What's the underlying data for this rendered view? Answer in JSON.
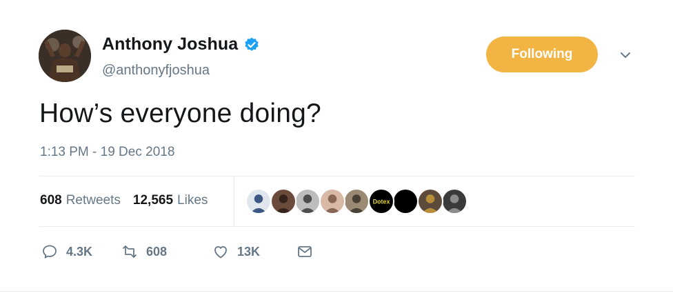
{
  "user": {
    "display_name": "Anthony Joshua",
    "handle": "@anthonyfjoshua",
    "verified": true
  },
  "follow_button": {
    "label": "Following",
    "color": "#f2b544"
  },
  "tweet": {
    "text": "How’s everyone doing?",
    "timestamp": "1:13 PM - 19 Dec 2018"
  },
  "stats": {
    "retweets": {
      "count": "608",
      "label": "Retweets"
    },
    "likes": {
      "count": "12,565",
      "label": "Likes"
    }
  },
  "likers": [
    {
      "name": "liker-avatar-1",
      "bg": "#dfe6ee",
      "fg": "#1f3d6e"
    },
    {
      "name": "liker-avatar-2",
      "bg": "#6a4a3a",
      "fg": "#2a1d16"
    },
    {
      "name": "liker-avatar-3",
      "bg": "#bdbdbd",
      "fg": "#3a3a3a"
    },
    {
      "name": "liker-avatar-4",
      "bg": "#d7b9a6",
      "fg": "#7a5646"
    },
    {
      "name": "liker-avatar-5",
      "bg": "#9a8a74",
      "fg": "#3b332a"
    },
    {
      "name": "liker-avatar-6",
      "bg": "#000000",
      "fg": "#e6d52a",
      "text": "Dotex"
    },
    {
      "name": "liker-avatar-7",
      "bg": "#000000",
      "fg": "#000000"
    },
    {
      "name": "liker-avatar-8",
      "bg": "#5c4a3a",
      "fg": "#c99a3b"
    },
    {
      "name": "liker-avatar-9",
      "bg": "#3a3a3a",
      "fg": "#9a9a9a"
    }
  ],
  "actions": {
    "reply": {
      "icon": "reply-icon",
      "count": "4.3K"
    },
    "retweet": {
      "icon": "retweet-icon",
      "count": "608"
    },
    "like": {
      "icon": "heart-icon",
      "count": "13K"
    },
    "message": {
      "icon": "envelope-icon"
    }
  },
  "colors": {
    "verified_badge": "#1da1f2",
    "secondary_text": "#657786",
    "primary_text": "#14171a"
  }
}
